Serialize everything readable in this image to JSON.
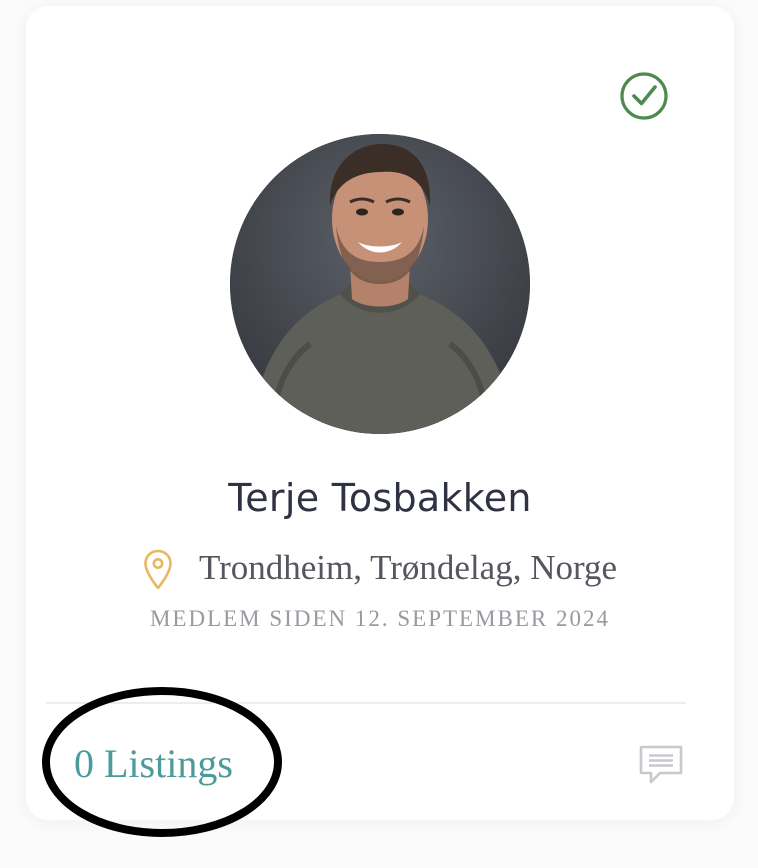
{
  "profile": {
    "name": "Terje Tosbakken",
    "location": "Trondheim, Trøndelag, Norge",
    "member_since": "MEDLEM SIDEN 12. SEPTEMBER 2024",
    "verified": true,
    "avatar_alt": "Terje Tosbakken"
  },
  "footer": {
    "listings_label": "0 Listings"
  },
  "icons": {
    "verified": "check-circle-icon",
    "location": "map-pin-icon",
    "message": "message-icon"
  },
  "colors": {
    "verified": "#4e8a4f",
    "pin": "#e9b75f",
    "listings": "#4a9b9a",
    "name": "#2f3242",
    "annotation": "#000000"
  }
}
